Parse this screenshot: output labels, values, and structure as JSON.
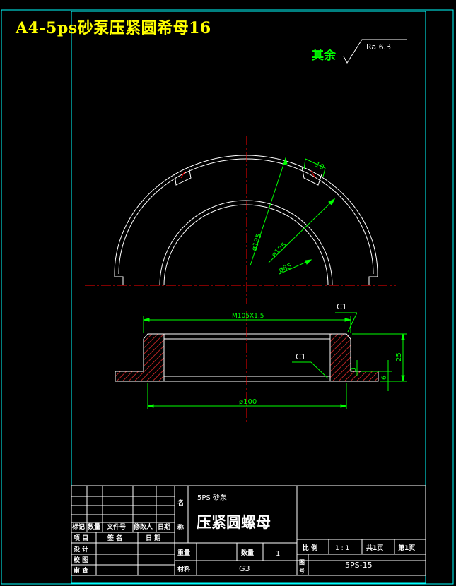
{
  "header": {
    "title": "A4-5ps砂泵压紧圆希母16"
  },
  "roughness": {
    "prefix": "其余",
    "symbol_text": "Ra 6.3"
  },
  "dimensions": {
    "slot_width": "10",
    "d135": "ø135",
    "d125": "ø125",
    "d85": "ø85",
    "thread": "M105X1.5",
    "chamfer_top": "C1",
    "chamfer_inner": "C1",
    "d100": "ø100",
    "h25": "25",
    "h3": "3",
    "h6": "6"
  },
  "title_block": {
    "unit": "5PS 砂泵",
    "part_name": "压紧圆螺母",
    "name_label": "名称",
    "weight_label": "重量",
    "qty_label": "数量",
    "qty_value": "1",
    "material_label": "材料",
    "material_value": "G3",
    "scale_label": "比 例",
    "scale_value": "1 : 1",
    "total_pages": "共1页",
    "page_no": "第1页",
    "drawing_no_label": "图号",
    "drawing_no_value": "5PS-15",
    "rev_headers": [
      "标记",
      "数量",
      "文件号",
      "修改人",
      "日期"
    ],
    "sign_rows": [
      {
        "role": "项 目",
        "c2": "签 名",
        "c3": "日 期"
      },
      {
        "role": "设 计",
        "c2": "",
        "c3": ""
      },
      {
        "role": "校 图",
        "c2": "",
        "c3": ""
      },
      {
        "role": "审 查",
        "c2": "",
        "c3": ""
      }
    ]
  },
  "colors": {
    "background": "#000000",
    "border": "#00ffff",
    "part": "#ffffff",
    "centerline": "#ff0000",
    "dimension": "#00ff00",
    "title": "#ffff00",
    "hatch": "#ff3030"
  }
}
